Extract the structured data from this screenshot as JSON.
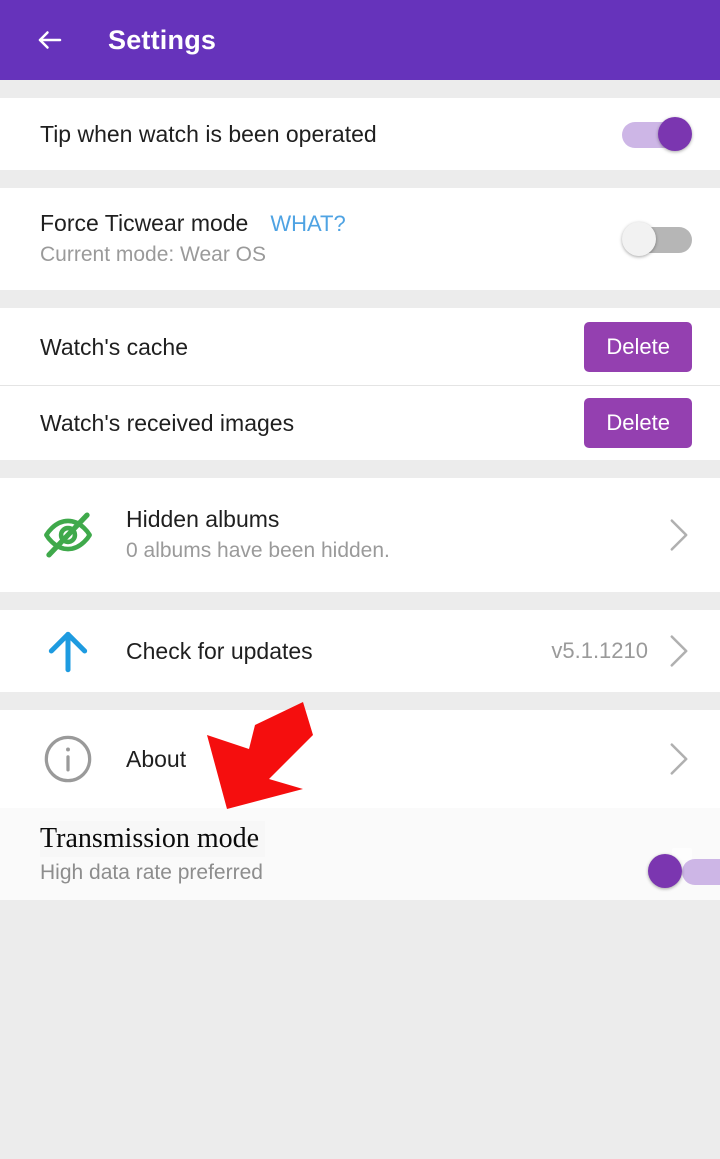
{
  "header": {
    "title": "Settings",
    "back_icon": "back-arrow-icon",
    "bg_color": "#6633BB"
  },
  "rows": {
    "tip": {
      "title": "Tip when watch is been operated",
      "toggle_state": "on"
    },
    "force_ticwear": {
      "title": "Force Ticwear mode",
      "link_label": "WHAT?",
      "link_color": "#4FA3E3",
      "subtitle": "Current mode: Wear OS",
      "toggle_state": "off"
    },
    "watch_cache": {
      "title": "Watch's cache",
      "button_label": "Delete"
    },
    "watch_images": {
      "title": "Watch's received images",
      "button_label": "Delete"
    },
    "hidden_albums": {
      "icon": "eye-off-icon",
      "icon_color": "#3FA94B",
      "title": "Hidden albums",
      "subtitle": "0 albums have been hidden."
    },
    "check_updates": {
      "icon": "arrow-up-icon",
      "icon_color": "#1E9BE0",
      "title": "Check for updates",
      "value": "v5.1.1210"
    },
    "about": {
      "icon": "info-circle-icon",
      "icon_color": "#9A9A9A",
      "title": "About"
    },
    "transmission_mode": {
      "title": "Transmission mode",
      "subtitle": "High data rate preferred",
      "toggle_state": "on"
    }
  },
  "annotation": {
    "arrow": "red-pointer-arrow",
    "color": "#F50E0E",
    "points_to": "transmission-mode-row"
  },
  "theme": {
    "accent_purple": "#6633BB",
    "button_purple": "#9440B0",
    "toggle_on_thumb": "#7B36B0",
    "toggle_on_track": "#CDB6E6",
    "page_background": "#ECECEC",
    "row_background": "#FFFFFF"
  }
}
